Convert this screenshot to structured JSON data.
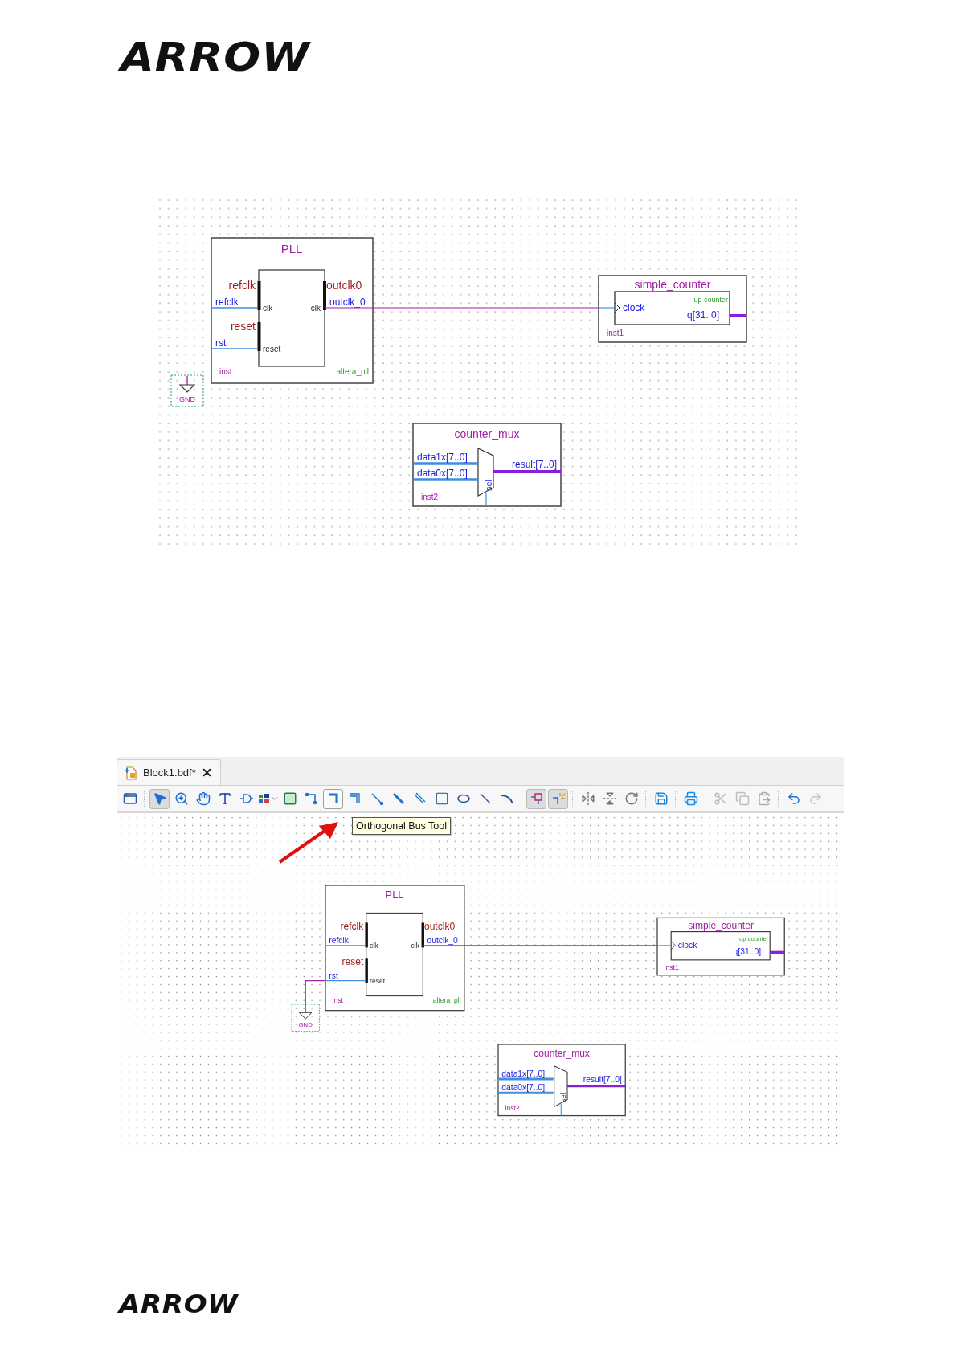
{
  "header_logo": "ARROW",
  "diagrams": [
    {
      "components": [
        {
          "kind": "pll",
          "title": "PLL",
          "inputs": [
            {
              "port": "refclk",
              "wire": "refclk",
              "pin": "clk"
            },
            {
              "port": "reset",
              "wire": "rst",
              "pin": "reset"
            }
          ],
          "output": {
            "port": "outclk0",
            "pin": "clk",
            "wire": "outclk_0"
          },
          "instance": "inst",
          "entity": "altera_pll"
        },
        {
          "kind": "gnd",
          "label": "GND"
        },
        {
          "kind": "counter",
          "title": "simple_counter",
          "input": "clock",
          "type": "up counter",
          "output": "q[31..0]",
          "instance": "inst1"
        },
        {
          "kind": "mux",
          "title": "counter_mux",
          "inputs": [
            "data1x[7..0]",
            "data0x[7..0]"
          ],
          "select": "sel",
          "output": "result[7..0]",
          "instance": "inst2"
        }
      ]
    }
  ],
  "editor": {
    "tab": {
      "title": "Block1.bdf*"
    },
    "toolbar": [
      {
        "kind": "project",
        "pressed": false,
        "hovered": false,
        "disabled": false
      },
      {
        "kind": "separator"
      },
      {
        "kind": "pointer",
        "pressed": true,
        "hovered": false,
        "disabled": false
      },
      {
        "kind": "zoom",
        "pressed": false,
        "hovered": false,
        "disabled": false
      },
      {
        "kind": "hand",
        "pressed": false,
        "hovered": false,
        "disabled": false
      },
      {
        "kind": "text",
        "pressed": false,
        "hovered": false,
        "disabled": false
      },
      {
        "kind": "symbol",
        "pressed": false,
        "hovered": false,
        "disabled": false
      },
      {
        "kind": "pin",
        "pressed": false,
        "hovered": false,
        "disabled": false
      },
      {
        "kind": "block",
        "pressed": false,
        "hovered": false,
        "disabled": false
      },
      {
        "kind": "wire",
        "pressed": false,
        "hovered": false,
        "disabled": false
      },
      {
        "kind": "bus",
        "pressed": false,
        "hovered": true,
        "disabled": false
      },
      {
        "kind": "conduit",
        "pressed": false,
        "hovered": false,
        "disabled": false
      },
      {
        "kind": "diag-wire",
        "pressed": false,
        "hovered": false,
        "disabled": false
      },
      {
        "kind": "diag-bus",
        "pressed": false,
        "hovered": false,
        "disabled": false
      },
      {
        "kind": "diag-conduit",
        "pressed": false,
        "hovered": false,
        "disabled": false
      },
      {
        "kind": "rectangle",
        "pressed": false,
        "hovered": false,
        "disabled": false
      },
      {
        "kind": "ellipse",
        "pressed": false,
        "hovered": false,
        "disabled": false
      },
      {
        "kind": "line",
        "pressed": false,
        "hovered": false,
        "disabled": false
      },
      {
        "kind": "arc",
        "pressed": false,
        "hovered": false,
        "disabled": false
      },
      {
        "kind": "separator"
      },
      {
        "kind": "rubberband",
        "pressed": true,
        "hovered": false,
        "disabled": false
      },
      {
        "kind": "partial",
        "pressed": true,
        "hovered": false,
        "disabled": false
      },
      {
        "kind": "separator"
      },
      {
        "kind": "flip-h",
        "pressed": false,
        "hovered": false,
        "disabled": false
      },
      {
        "kind": "flip-v",
        "pressed": false,
        "hovered": false,
        "disabled": false
      },
      {
        "kind": "rotate",
        "pressed": false,
        "hovered": false,
        "disabled": false
      },
      {
        "kind": "separator"
      },
      {
        "kind": "save",
        "pressed": false,
        "hovered": false,
        "disabled": false
      },
      {
        "kind": "separator"
      },
      {
        "kind": "print",
        "pressed": false,
        "hovered": false,
        "disabled": false
      },
      {
        "kind": "separator"
      },
      {
        "kind": "cut",
        "pressed": false,
        "hovered": false,
        "disabled": true
      },
      {
        "kind": "copy",
        "pressed": false,
        "hovered": false,
        "disabled": true
      },
      {
        "kind": "paste",
        "pressed": false,
        "hovered": false,
        "disabled": true
      },
      {
        "kind": "separator"
      },
      {
        "kind": "undo",
        "pressed": false,
        "hovered": false,
        "disabled": false
      },
      {
        "kind": "redo",
        "pressed": false,
        "hovered": false,
        "disabled": true
      }
    ],
    "tooltip": "Orthogonal Bus Tool",
    "diagram": {
      "components": [
        {
          "kind": "pll",
          "title": "PLL",
          "inputs": [
            {
              "port": "refclk",
              "wire": "refclk",
              "pin": "clk"
            },
            {
              "port": "reset",
              "wire": "rst",
              "pin": "reset"
            }
          ],
          "output": {
            "port": "outclk0",
            "pin": "clk",
            "wire": "outclk_0"
          },
          "instance": "inst",
          "entity": "altera_pll"
        },
        {
          "kind": "gnd",
          "label": "GND"
        },
        {
          "kind": "counter",
          "title": "simple_counter",
          "input": "clock",
          "type": "up counter",
          "output": "q[31..0]",
          "instance": "inst1"
        },
        {
          "kind": "mux",
          "title": "counter_mux",
          "inputs": [
            "data1x[7..0]",
            "data0x[7..0]"
          ],
          "select": "sel",
          "output": "result[7..0]",
          "instance": "inst2"
        }
      ]
    }
  },
  "footer_logo": "ARROW"
}
